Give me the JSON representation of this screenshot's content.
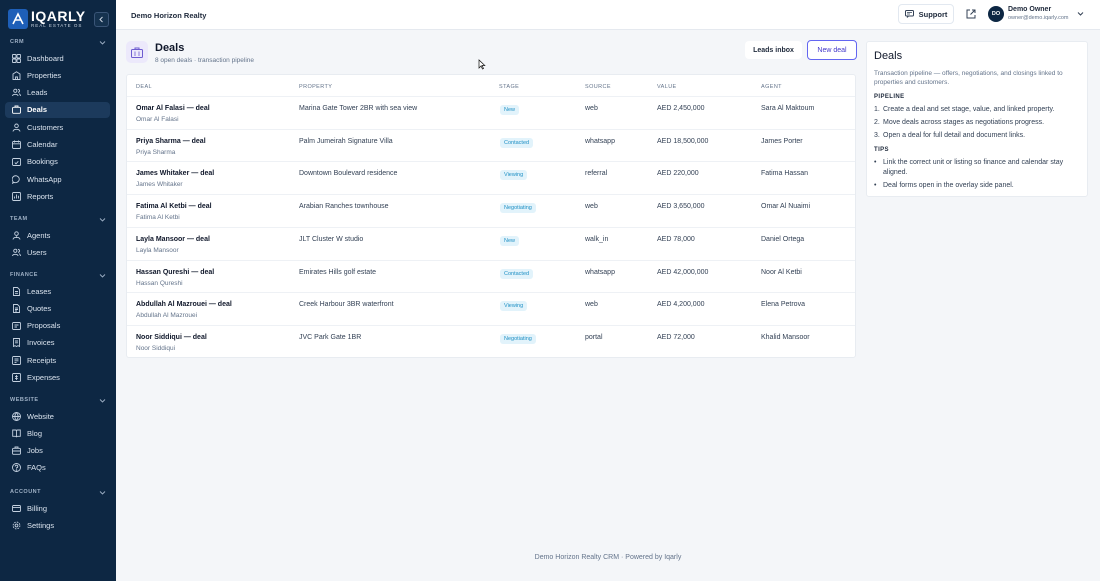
{
  "brand": {
    "name": "IQARLY",
    "tagline": "REAL ESTATE OS"
  },
  "sidebar": {
    "sections": [
      {
        "label": "CRM",
        "items": [
          {
            "label": "Dashboard",
            "icon": "dashboard-icon"
          },
          {
            "label": "Properties",
            "icon": "building-icon"
          },
          {
            "label": "Leads",
            "icon": "users-icon"
          },
          {
            "label": "Deals",
            "icon": "briefcase-icon",
            "active": true
          },
          {
            "label": "Customers",
            "icon": "user-icon"
          },
          {
            "label": "Calendar",
            "icon": "calendar-icon"
          },
          {
            "label": "Bookings",
            "icon": "booking-icon"
          },
          {
            "label": "WhatsApp",
            "icon": "chat-icon"
          },
          {
            "label": "Reports",
            "icon": "report-icon"
          }
        ]
      },
      {
        "label": "TEAM",
        "items": [
          {
            "label": "Agents",
            "icon": "agent-icon"
          },
          {
            "label": "Users",
            "icon": "users-icon"
          }
        ]
      },
      {
        "label": "FINANCE",
        "items": [
          {
            "label": "Leases",
            "icon": "document-icon"
          },
          {
            "label": "Quotes",
            "icon": "quote-icon"
          },
          {
            "label": "Proposals",
            "icon": "proposal-icon"
          },
          {
            "label": "Invoices",
            "icon": "invoice-icon"
          },
          {
            "label": "Receipts",
            "icon": "receipt-icon"
          },
          {
            "label": "Expenses",
            "icon": "expense-icon"
          }
        ]
      },
      {
        "label": "WEBSITE",
        "items": [
          {
            "label": "Website",
            "icon": "globe-icon"
          },
          {
            "label": "Blog",
            "icon": "book-icon"
          },
          {
            "label": "Jobs",
            "icon": "jobs-icon"
          },
          {
            "label": "FAQs",
            "icon": "help-icon"
          }
        ]
      },
      {
        "label": "ACCOUNT",
        "items": [
          {
            "label": "Billing",
            "icon": "card-icon"
          },
          {
            "label": "Settings",
            "icon": "gear-icon"
          }
        ]
      }
    ]
  },
  "topbar": {
    "org_name": "Demo Horizon Realty",
    "support_label": "Support",
    "user": {
      "initials": "DO",
      "name": "Demo Owner",
      "email": "owner@demo.iqarly.com"
    }
  },
  "page": {
    "title": "Deals",
    "subtitle": "8 open deals · transaction pipeline",
    "leads_inbox_label": "Leads inbox",
    "new_deal_label": "New deal"
  },
  "table": {
    "columns": [
      "DEAL",
      "PROPERTY",
      "STAGE",
      "SOURCE",
      "VALUE",
      "AGENT"
    ],
    "rows": [
      {
        "deal": "Omar Al Falasi — deal",
        "customer": "Omar Al Falasi",
        "property": "Marina Gate Tower 2BR with sea view",
        "stage": "New",
        "source": "web",
        "value": "AED 2,450,000",
        "agent": "Sara Al Maktoum"
      },
      {
        "deal": "Priya Sharma — deal",
        "customer": "Priya Sharma",
        "property": "Palm Jumeirah Signature Villa",
        "stage": "Contacted",
        "source": "whatsapp",
        "value": "AED 18,500,000",
        "agent": "James Porter"
      },
      {
        "deal": "James Whitaker — deal",
        "customer": "James Whitaker",
        "property": "Downtown Boulevard residence",
        "stage": "Viewing",
        "source": "referral",
        "value": "AED 220,000",
        "agent": "Fatima Hassan"
      },
      {
        "deal": "Fatima Al Ketbi — deal",
        "customer": "Fatima Al Ketbi",
        "property": "Arabian Ranches townhouse",
        "stage": "Negotiating",
        "source": "web",
        "value": "AED 3,650,000",
        "agent": "Omar Al Nuaimi"
      },
      {
        "deal": "Layla Mansoor — deal",
        "customer": "Layla Mansoor",
        "property": "JLT Cluster W studio",
        "stage": "New",
        "source": "walk_in",
        "value": "AED 78,000",
        "agent": "Daniel Ortega"
      },
      {
        "deal": "Hassan Qureshi — deal",
        "customer": "Hassan Qureshi",
        "property": "Emirates Hills golf estate",
        "stage": "Contacted",
        "source": "whatsapp",
        "value": "AED 42,000,000",
        "agent": "Noor Al Ketbi"
      },
      {
        "deal": "Abdullah Al Mazrouei — deal",
        "customer": "Abdullah Al Mazrouei",
        "property": "Creek Harbour 3BR waterfront",
        "stage": "Viewing",
        "source": "web",
        "value": "AED 4,200,000",
        "agent": "Elena Petrova"
      },
      {
        "deal": "Noor Siddiqui — deal",
        "customer": "Noor Siddiqui",
        "property": "JVC Park Gate 1BR",
        "stage": "Negotiating",
        "source": "portal",
        "value": "AED 72,000",
        "agent": "Khalid Mansoor"
      }
    ]
  },
  "info_panel": {
    "title": "Deals",
    "description": "Transaction pipeline — offers, negotiations, and closings linked to properties and customers.",
    "pipeline_heading": "PIPELINE",
    "pipeline_steps": [
      "Create a deal and set stage, value, and linked property.",
      "Move deals across stages as negotiations progress.",
      "Open a deal for full detail and document links."
    ],
    "tips_heading": "TIPS",
    "tips": [
      "Link the correct unit or listing so finance and calendar stay aligned.",
      "Deal forms open in the overlay side panel."
    ]
  },
  "footer": {
    "text": "Demo Horizon Realty CRM · Powered by Iqarly"
  },
  "colors": {
    "sidebar_bg": "#0d2743",
    "accent": "#6366f1",
    "stage_badge": "#1d8fc4"
  }
}
